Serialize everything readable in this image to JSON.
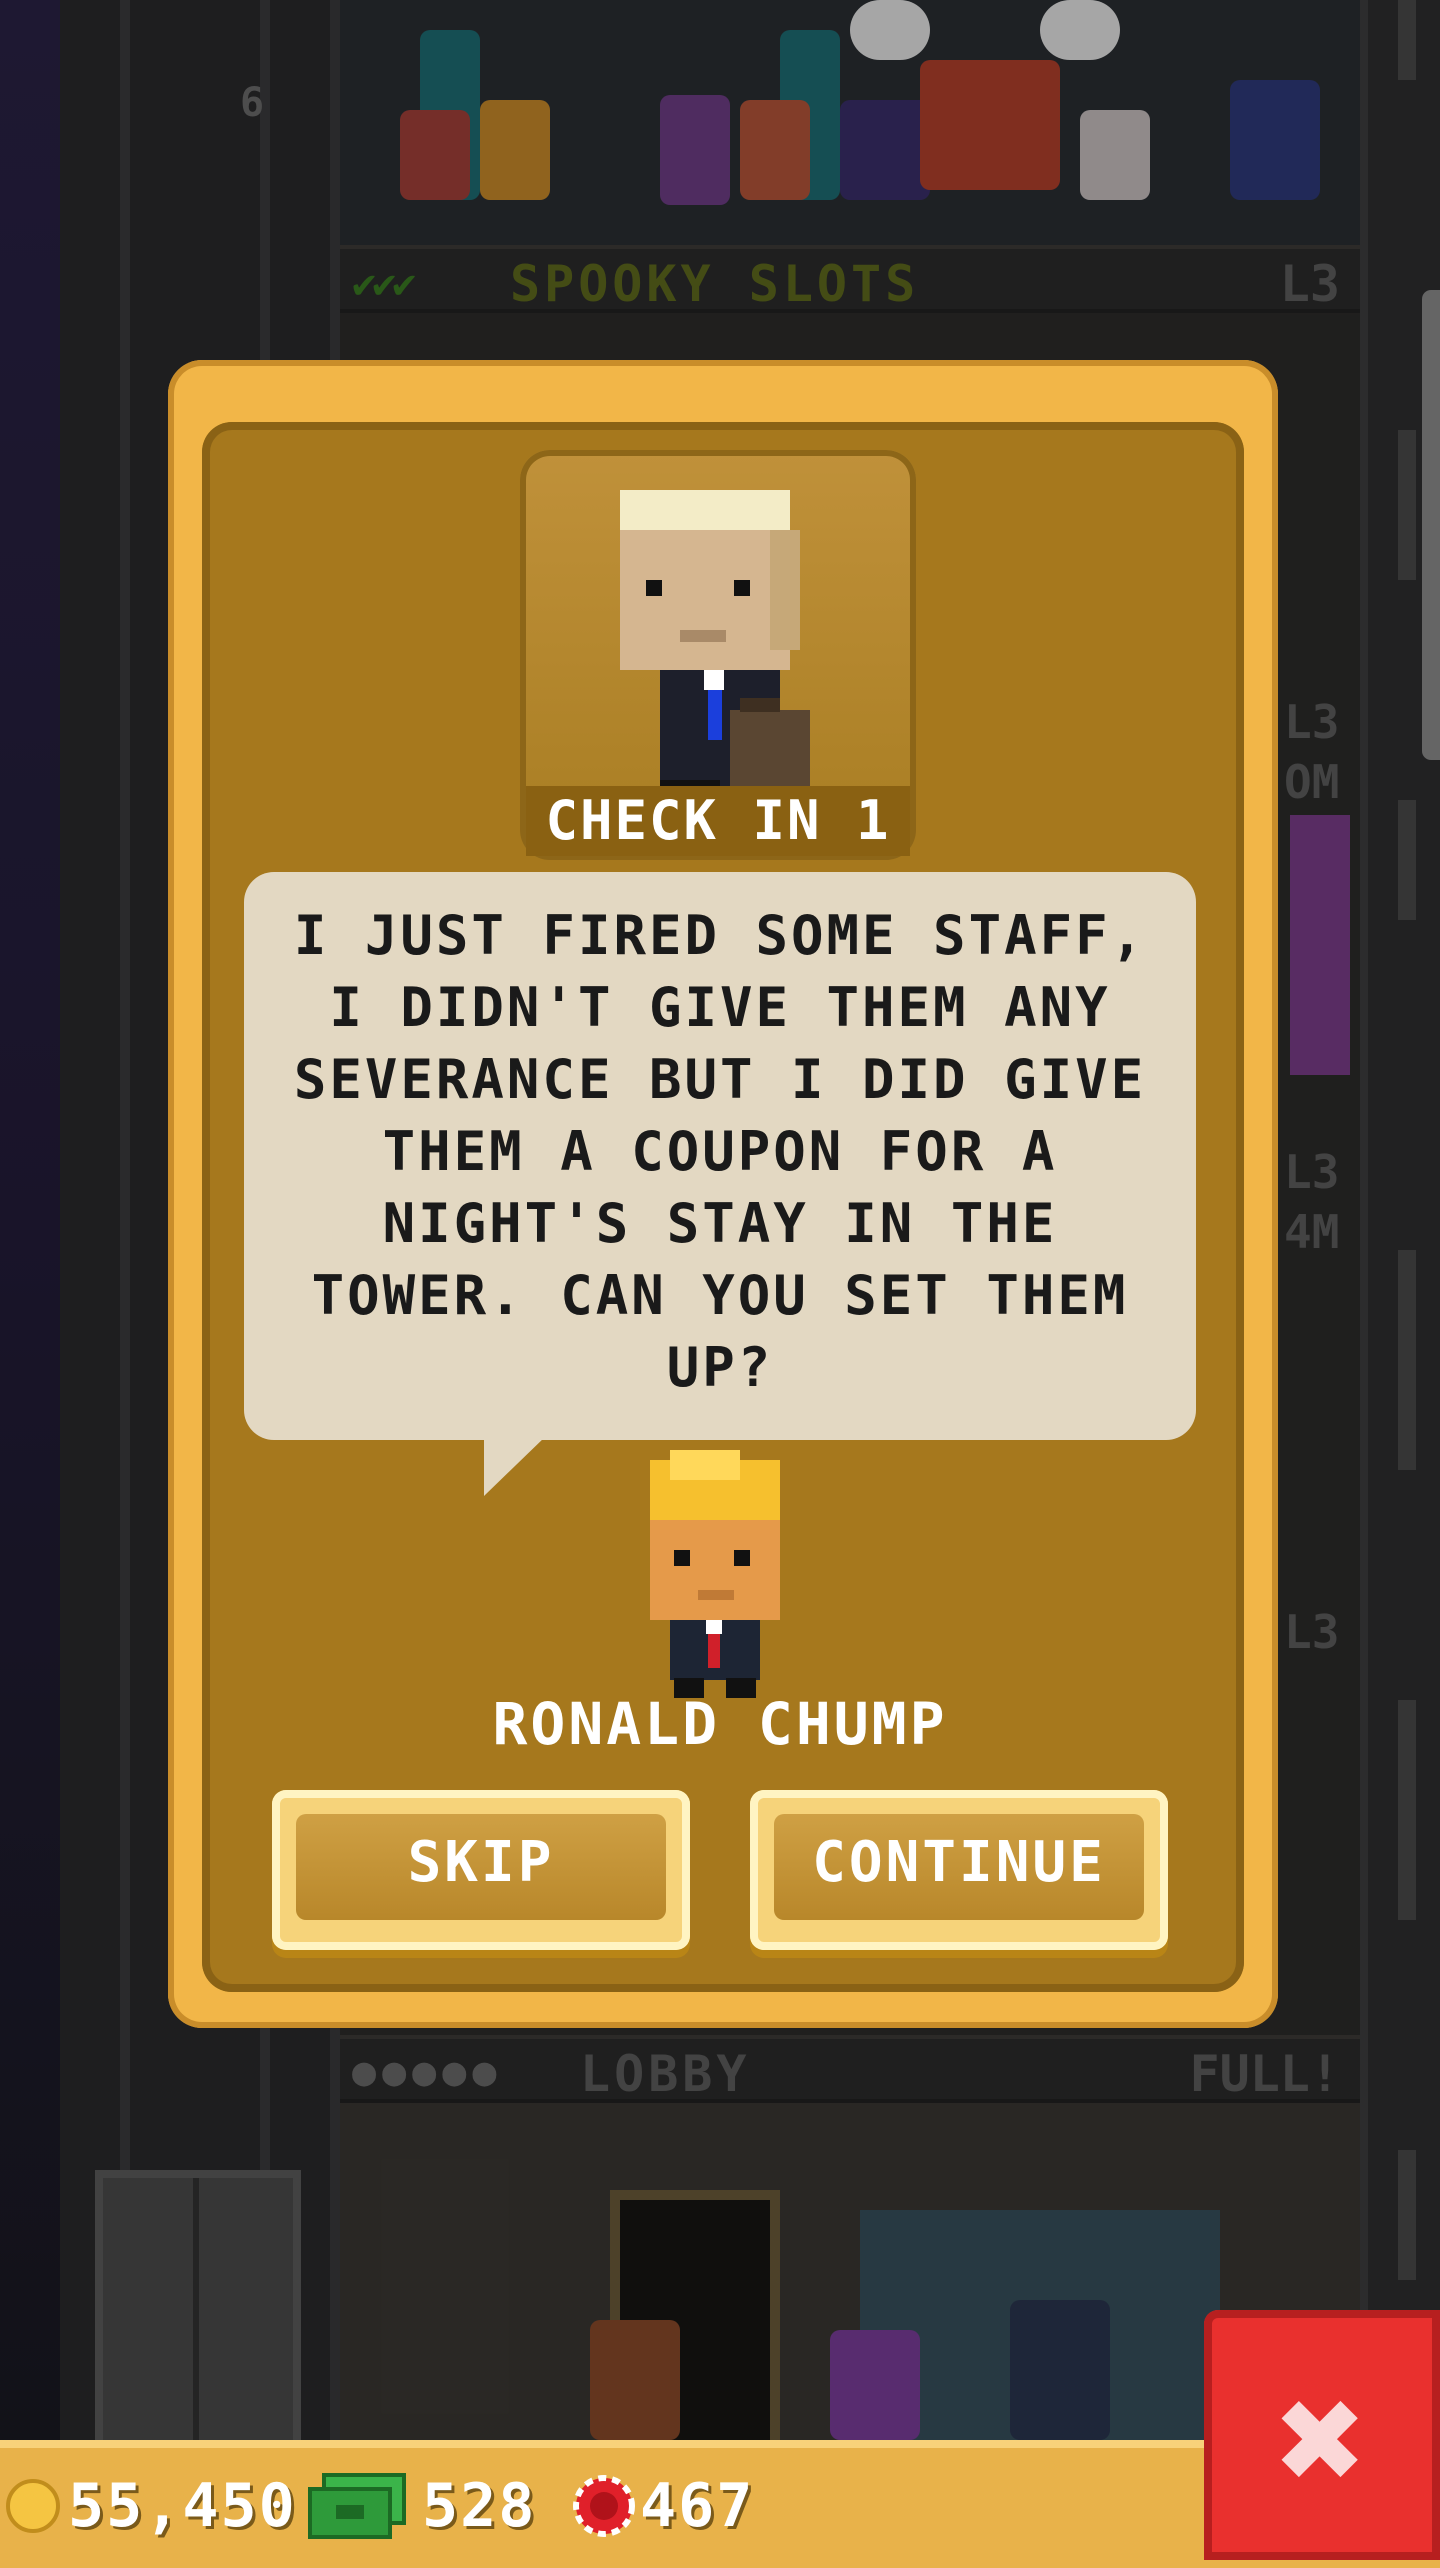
{
  "background": {
    "floor_number": "6",
    "top_floor": {
      "name": "SPOOKY SLOTS",
      "level": "L3",
      "checks": "✔✔✔"
    },
    "side_levels": [
      "L3",
      "L3",
      "L3"
    ],
    "side_labels": [
      "OM",
      "4M"
    ],
    "lobby": {
      "name": "LOBBY",
      "status": "FULL!",
      "stars": "●●●●●"
    }
  },
  "dialog": {
    "mission_label": "CHECK IN 1",
    "message": "I JUST FIRED SOME STAFF, I DIDN'T GIVE THEM ANY SEVERANCE BUT I DID GIVE THEM A COUPON FOR A NIGHT'S STAY IN THE TOWER. CAN YOU SET THEM UP?",
    "character_name": "RONALD CHUMP",
    "skip_label": "SKIP",
    "continue_label": "CONTINUE"
  },
  "hud": {
    "coins": "55,450",
    "bux": "528",
    "tokens": "467",
    "close_label": "✖"
  },
  "colors": {
    "dialog_border": "#f2b648",
    "dialog_fill": "#a6781d",
    "bubble": "#e3d8c2",
    "close_red": "#e9302e",
    "coin_gold": "#f5c542",
    "bux_green": "#2e9a3a",
    "token_red": "#e0202a"
  },
  "icons": [
    "coin-icon",
    "bux-icon",
    "token-icon",
    "close-icon"
  ]
}
